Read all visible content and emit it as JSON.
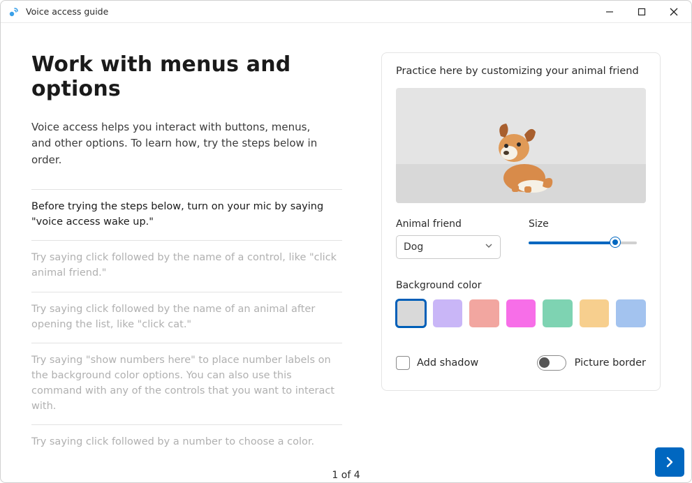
{
  "window_title": "Voice access guide",
  "heading": "Work with menus and options",
  "intro": "Voice access helps you interact with buttons, menus, and other options. To learn how, try the steps below in order.",
  "steps": [
    "Before trying the steps below, turn on your mic by saying \"voice access wake up.\"",
    "Try saying click followed by the name of a control, like \"click animal friend.\"",
    "Try saying click followed by the name of an animal after opening the list, like \"click cat.\"",
    "Try saying \"show numbers here\" to place number labels on the background color options. You can also use this command with any of the controls that you want to interact with.",
    "Try saying click followed by a number to choose a color."
  ],
  "active_step_index": 0,
  "practice": {
    "heading": "Practice here by customizing your animal friend",
    "animal_label": "Animal friend",
    "animal_value": "Dog",
    "size_label": "Size",
    "size_percent": 80,
    "bg_label": "Background color",
    "colors": [
      "#d9d9d9",
      "#c9b6f7",
      "#f2a6a0",
      "#f76ee8",
      "#7ed3b2",
      "#f7cf8e",
      "#a3c3ef"
    ],
    "selected_color_index": 0,
    "add_shadow_label": "Add shadow",
    "add_shadow_checked": false,
    "picture_border_label": "Picture border",
    "picture_border_on": false
  },
  "pager": "1 of 4"
}
